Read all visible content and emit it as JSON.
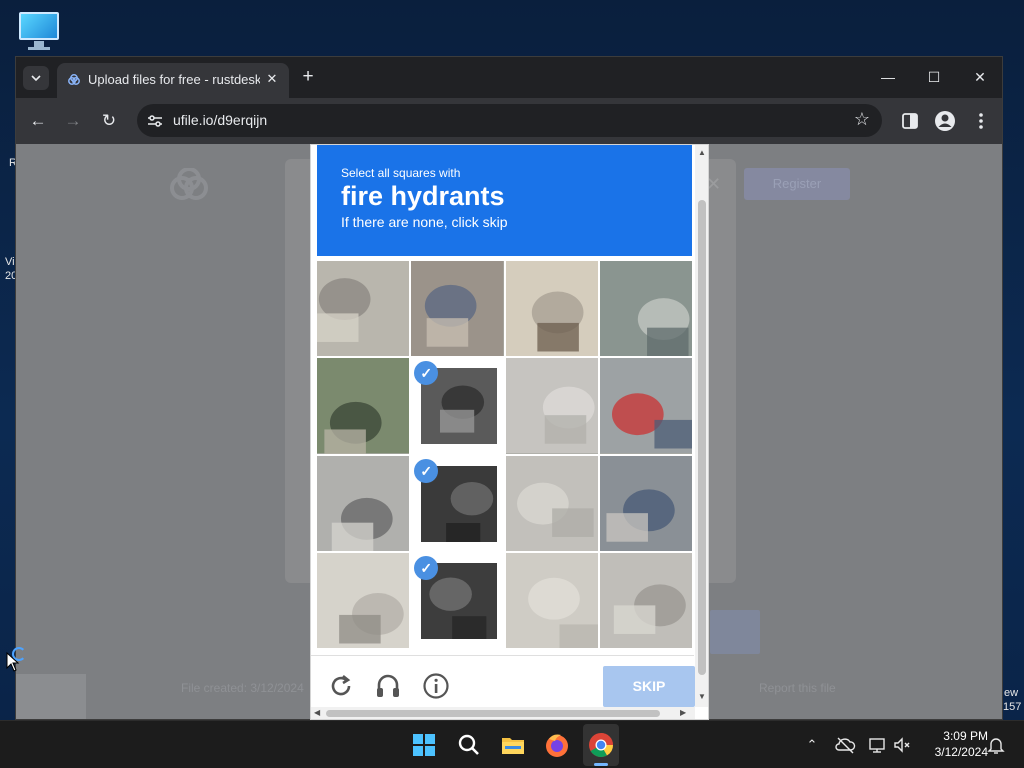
{
  "browser": {
    "tab_title": "Upload files for free - rustdesk-",
    "url": "ufile.io/d9erqijn"
  },
  "captcha": {
    "instruction_small": "Select all squares with",
    "target": "fire hydrants",
    "hint": "If there are none, click skip",
    "skip_label": "SKIP",
    "tiles": [
      {
        "selected": false
      },
      {
        "selected": false
      },
      {
        "selected": false
      },
      {
        "selected": false
      },
      {
        "selected": false
      },
      {
        "selected": true
      },
      {
        "selected": false
      },
      {
        "selected": false
      },
      {
        "selected": false
      },
      {
        "selected": true
      },
      {
        "selected": false
      },
      {
        "selected": false
      },
      {
        "selected": false
      },
      {
        "selected": true
      },
      {
        "selected": false
      },
      {
        "selected": false
      }
    ]
  },
  "background_page": {
    "register_label": "Register",
    "footer_left": "File created: 3/12/2024",
    "footer_right": "Report this file"
  },
  "desktop": {
    "edge_left_1": "R",
    "edge_left_2": "Vi",
    "edge_left_3": "20",
    "edge_right_1": "ew",
    "edge_right_2": "157"
  },
  "taskbar": {
    "time": "3:09 PM",
    "date": "3/12/2024"
  },
  "colors": {
    "captcha_blue": "#1a73e8",
    "skip_disabled": "#a8c6ef",
    "check_blue": "#4a90e2"
  }
}
